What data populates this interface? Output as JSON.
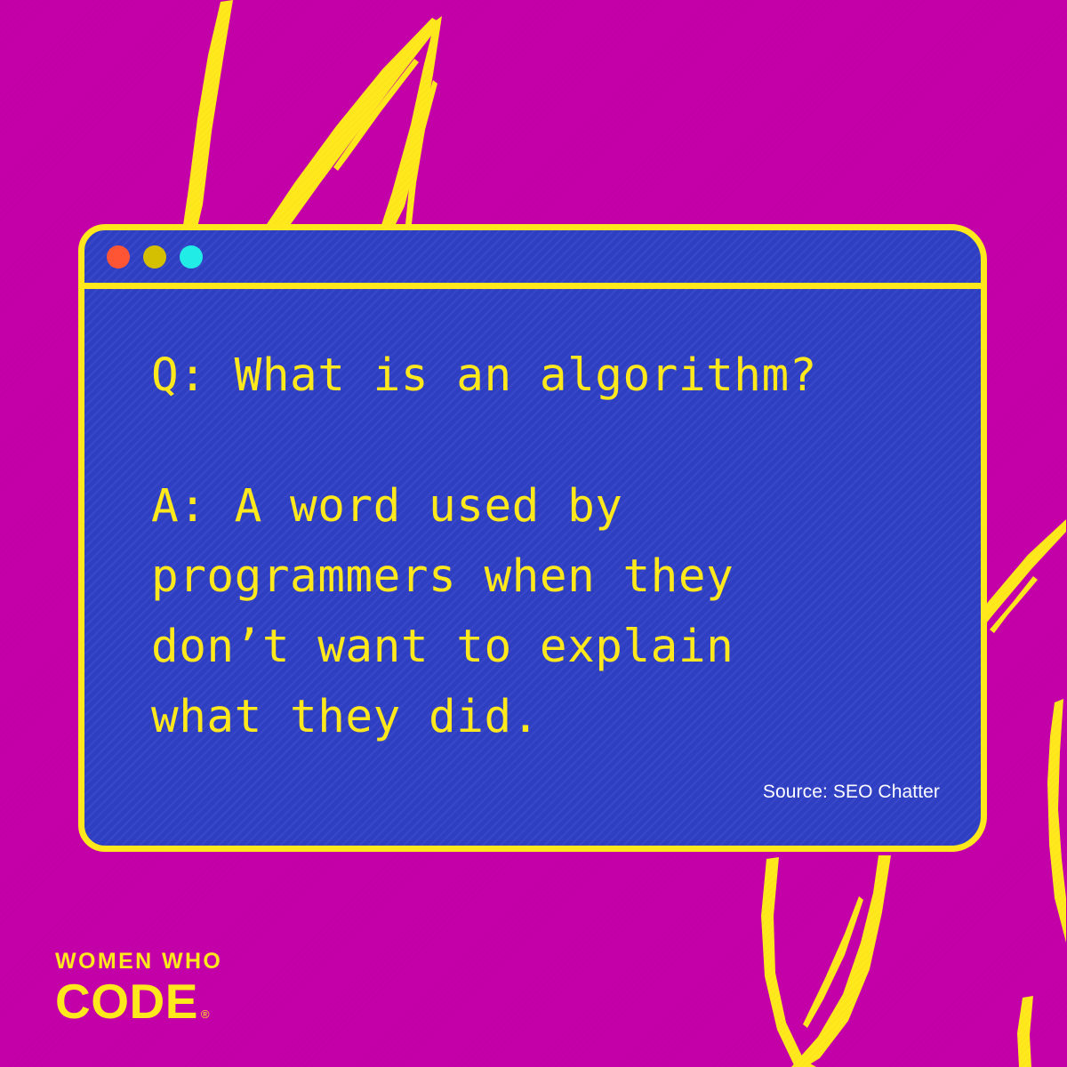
{
  "canvas": {
    "background_color": "#c400a8",
    "accent_yellow": "#ffe81c",
    "window_blue": "#2f40c6"
  },
  "window": {
    "title_bar": {
      "dots": [
        {
          "name": "close-dot",
          "color": "#ff5535"
        },
        {
          "name": "minimize-dot",
          "color": "#d4c000"
        },
        {
          "name": "maximize-dot",
          "color": "#22ece6"
        }
      ]
    },
    "content": {
      "question": "Q: What is an algorithm?",
      "answer": "A: A word used by\nprogrammers when they\ndon’t want to explain\nwhat they did.",
      "source": "Source: SEO Chatter"
    }
  },
  "logo": {
    "line1": "WOMEN WHO",
    "line2": "CODE",
    "registered_mark": "®"
  }
}
